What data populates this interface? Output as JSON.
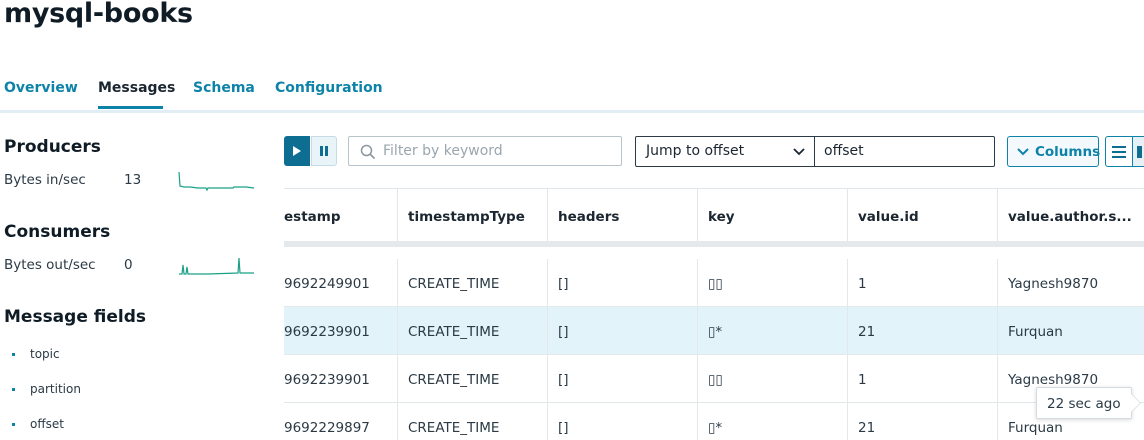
{
  "header": {
    "title": "mysql-books"
  },
  "tabs": [
    {
      "label": "Overview"
    },
    {
      "label": "Messages",
      "active": true
    },
    {
      "label": "Schema"
    },
    {
      "label": "Configuration"
    }
  ],
  "sidebar": {
    "producers": {
      "heading": "Producers",
      "metric_label": "Bytes in/sec",
      "metric_value": "13"
    },
    "consumers": {
      "heading": "Consumers",
      "metric_label": "Bytes out/sec",
      "metric_value": "0"
    },
    "fields": {
      "heading": "Message fields",
      "items": [
        "topic",
        "partition",
        "offset"
      ]
    }
  },
  "toolbar": {
    "filter_placeholder": "Filter by keyword",
    "jump_select_value": "Jump to offset",
    "offset_value": "offset",
    "columns_label": "Columns"
  },
  "table": {
    "headers": [
      "estamp",
      "timestampType",
      "headers",
      "key",
      "value.id",
      "value.author.s..."
    ],
    "rows": [
      [
        "9692249901",
        "CREATE_TIME",
        "[]",
        "▯▯",
        "1",
        "Yagnesh9870"
      ],
      [
        "9692239901",
        "CREATE_TIME",
        "[]",
        "▯*",
        "21",
        "Furquan"
      ],
      [
        "9692239901",
        "CREATE_TIME",
        "[]",
        "▯▯",
        "1",
        "Yagnesh9870"
      ],
      [
        "9692229897",
        "CREATE_TIME",
        "[]",
        "▯*",
        "21",
        "Furquan"
      ]
    ]
  },
  "tooltip": {
    "text": "22 sec ago"
  },
  "colors": {
    "accent": "#0e83a9",
    "sparkline": "#19a187",
    "row_highlight": "#e2f3fa"
  },
  "icons": [
    "play-icon",
    "pause-icon",
    "search-icon",
    "chevron-down-icon",
    "list-view-icon"
  ]
}
